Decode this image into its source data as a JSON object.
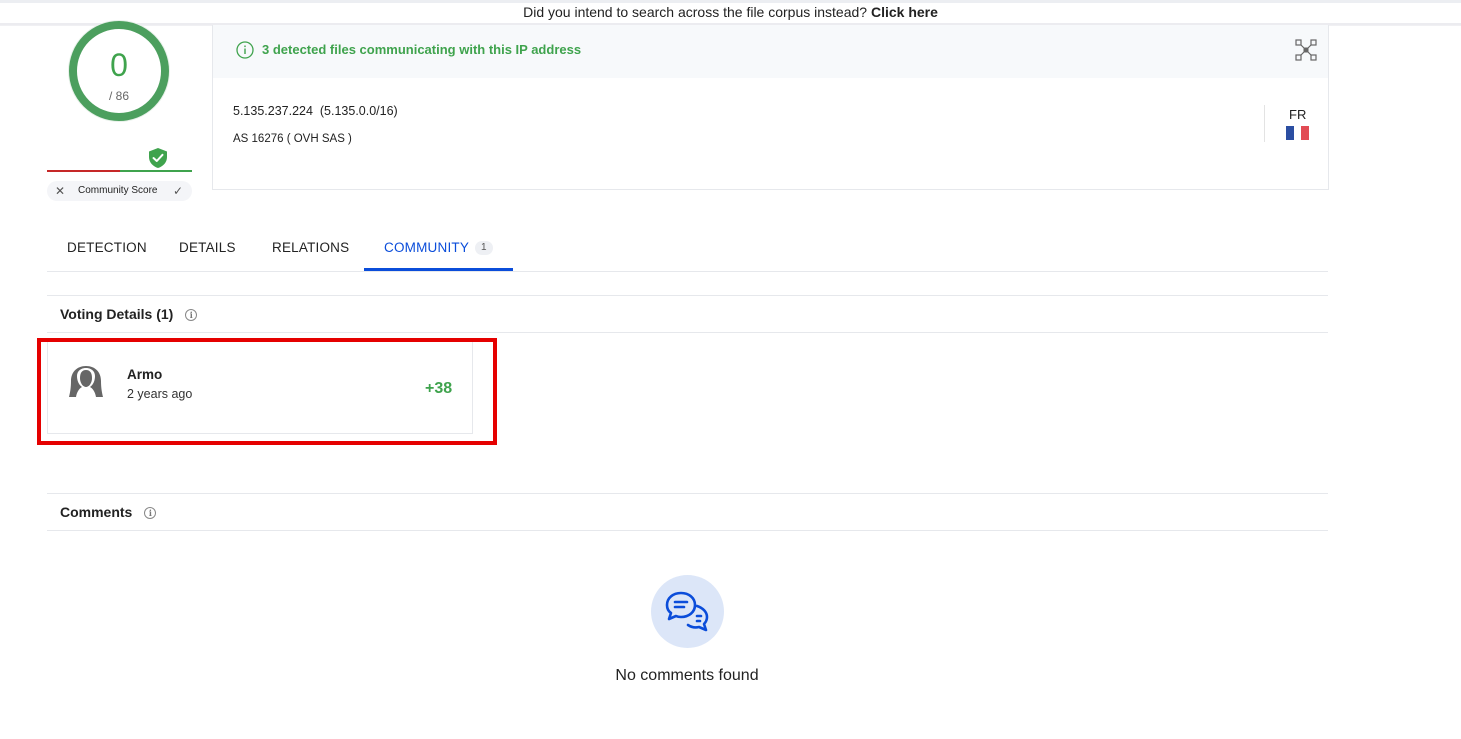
{
  "banner": {
    "text": "Did you intend to search across the file corpus instead?",
    "link": "Click here"
  },
  "score": {
    "value": "0",
    "total": "/ 86",
    "community_label": "Community Score",
    "colors": {
      "clean": "#3fa34d",
      "malicious": "#c62828"
    }
  },
  "info": {
    "detected_message": "3 detected files communicating with this IP address",
    "ip_line": "5.135.237.224  (5.135.0.0/16)",
    "as_line": "AS 16276 ( OVH SAS )",
    "country_code": "FR",
    "flag_colors": [
      "#2b4ea2",
      "#ffffff",
      "#e24b54"
    ]
  },
  "tabs": [
    {
      "label": "DETECTION",
      "active": false
    },
    {
      "label": "DETAILS",
      "active": false
    },
    {
      "label": "RELATIONS",
      "active": false
    },
    {
      "label": "COMMUNITY",
      "active": true,
      "badge": "1"
    }
  ],
  "voting": {
    "title": "Voting Details (1)",
    "votes": [
      {
        "user": "Armo",
        "time": "2 years ago",
        "value": "+38"
      }
    ]
  },
  "comments": {
    "title": "Comments",
    "empty_text": "No comments found"
  },
  "accent": "#0b4dda"
}
